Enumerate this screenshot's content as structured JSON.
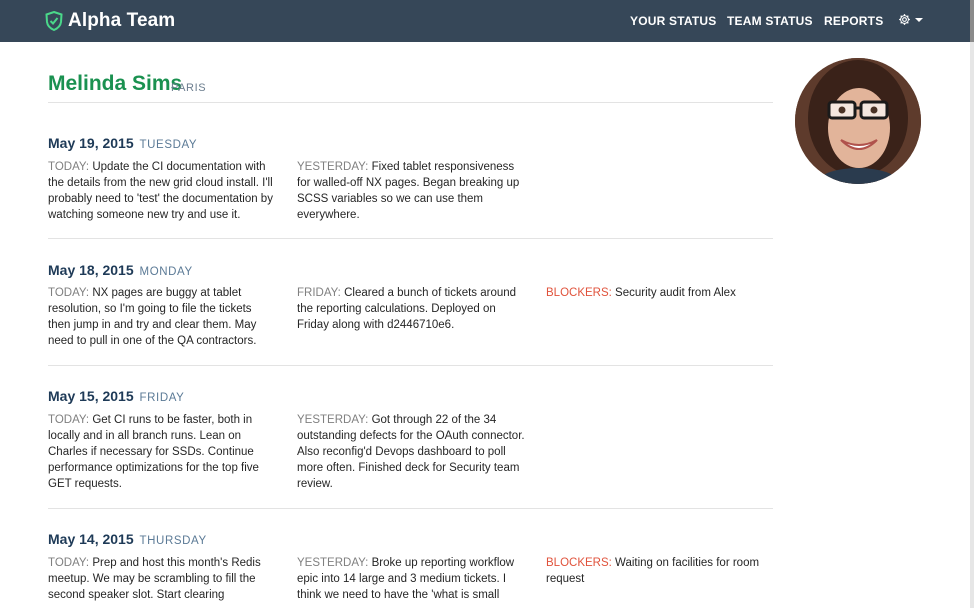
{
  "app": {
    "brand": "Alpha Team"
  },
  "nav": {
    "your_status": "YOUR STATUS",
    "team_status": "TEAM STATUS",
    "reports": "REPORTS"
  },
  "icons": {
    "brand": "shield-check-icon",
    "settings": "gear-icon",
    "dropdown": "caret-down-icon"
  },
  "colors": {
    "navbar": "#364758",
    "name": "#1a9150",
    "date": "#1e3a57",
    "blockers": "#e0533c"
  },
  "profile": {
    "name": "Melinda Sims",
    "location": "PARIS"
  },
  "entries": [
    {
      "date": "May 19, 2015",
      "day": "TUESDAY",
      "col1_label": "TODAY:",
      "col1_text": "Update the CI documentation with the details from the new grid cloud install. I'll probably need to 'test' the documentation by watching someone new try and use it.",
      "col2_label": "YESTERDAY:",
      "col2_text": "Fixed tablet responsiveness for walled-off NX pages. Began breaking up SCSS variables so we can use them everywhere."
    },
    {
      "date": "May 18, 2015",
      "day": "MONDAY",
      "col1_label": "TODAY:",
      "col1_text": "NX pages are buggy at tablet resolution, so I'm going to file the tickets then jump in and try and clear them. May need to pull in one of the QA contractors.",
      "col2_label": "FRIDAY:",
      "col2_text": "Cleared a bunch of tickets around the reporting calculations. Deployed on Friday along with d2446710e6.",
      "col3_label": "BLOCKERS:",
      "col3_text": "Security audit from Alex"
    },
    {
      "date": "May 15, 2015",
      "day": "FRIDAY",
      "col1_label": "TODAY:",
      "col1_text": "Get CI runs to be faster, both in locally and in all branch runs. Lean on Charles if necessary for SSDs. Continue performance optimizations for the top five GET requests.",
      "col2_label": "YESTERDAY:",
      "col2_text": "Got through 22 of the 34 outstanding defects for the OAuth connector. Also reconfig'd Devops dashboard to poll more often. Finished deck for Security team review."
    },
    {
      "date": "May 14, 2015",
      "day": "THURSDAY",
      "col1_label": "TODAY:",
      "col1_text": "Prep and host this month's Redis meetup. We may be scrambling to fill the second speaker slot. Start clearing",
      "col2_label": "YESTERDAY:",
      "col2_text": "Broke up reporting workflow epic into 14 large and 3 medium tickets. I think we need to have the 'what is small",
      "col3_label": "BLOCKERS:",
      "col3_text": "Waiting on facilities for room request"
    }
  ]
}
